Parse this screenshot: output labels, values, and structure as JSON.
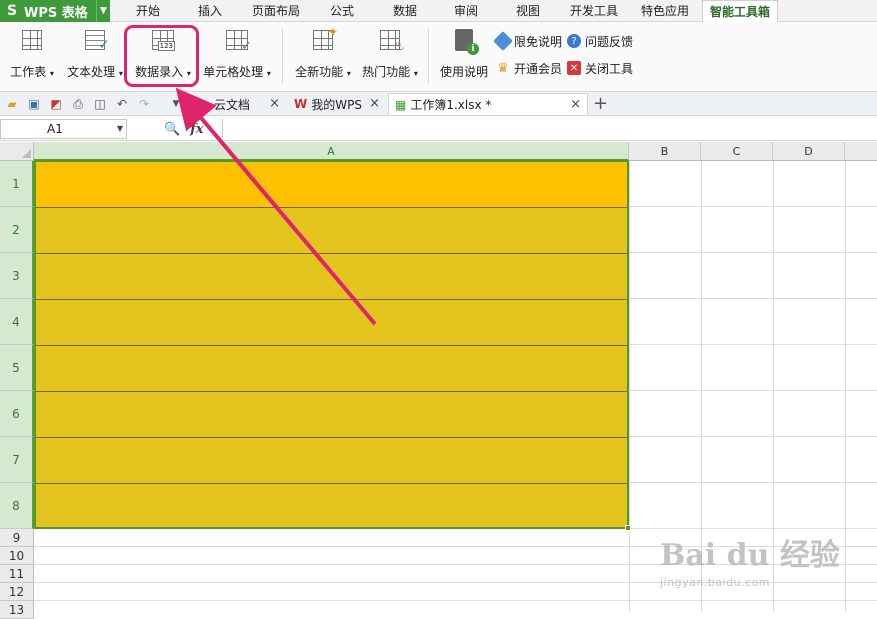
{
  "app": {
    "title": "WPS 表格",
    "logo": "S"
  },
  "menu": {
    "tabs": [
      "开始",
      "插入",
      "页面布局",
      "公式",
      "数据",
      "审阅",
      "视图",
      "开发工具",
      "特色应用",
      "智能工具箱"
    ],
    "active": "智能工具箱"
  },
  "ribbon": {
    "buttons": [
      {
        "label": "工作表",
        "icon": "worksheet-icon"
      },
      {
        "label": "文本处理",
        "icon": "text-process-icon"
      },
      {
        "label": "数据录入",
        "icon": "data-entry-icon"
      },
      {
        "label": "单元格处理",
        "icon": "cell-process-icon"
      },
      {
        "label": "全新功能",
        "icon": "new-feature-icon"
      },
      {
        "label": "热门功能",
        "icon": "hot-feature-icon"
      },
      {
        "label": "使用说明",
        "icon": "manual-icon"
      }
    ],
    "small": [
      {
        "label": "限免说明",
        "icon": "tag-icon"
      },
      {
        "label": "问题反馈",
        "icon": "question-icon"
      },
      {
        "label": "开通会员",
        "icon": "crown-icon"
      },
      {
        "label": "关闭工具",
        "icon": "close-tool-icon"
      }
    ],
    "data_entry_badge": "123"
  },
  "doc_tabs": [
    {
      "label": "云文档",
      "icon": "cloud-icon"
    },
    {
      "label": "我的WPS",
      "icon": "wps-icon"
    },
    {
      "label": "工作簿1.xlsx *",
      "icon": "excel-icon"
    }
  ],
  "formula_bar": {
    "cell_ref": "A1",
    "fx": "fx",
    "value": ""
  },
  "sheet": {
    "columns": [
      "A",
      "B",
      "C",
      "D"
    ],
    "rows": [
      "1",
      "2",
      "3",
      "4",
      "5",
      "6",
      "7",
      "8",
      "9",
      "10",
      "11",
      "12",
      "13"
    ],
    "selected_column": "A",
    "row1_color": "#ffc000",
    "selection_color": "#e3c51e"
  },
  "watermark": {
    "brand": "Bai du 经验",
    "url": "jingyan.baidu.com"
  },
  "colors": {
    "accent": "#3f9a3a",
    "highlight": "#e0236d"
  }
}
